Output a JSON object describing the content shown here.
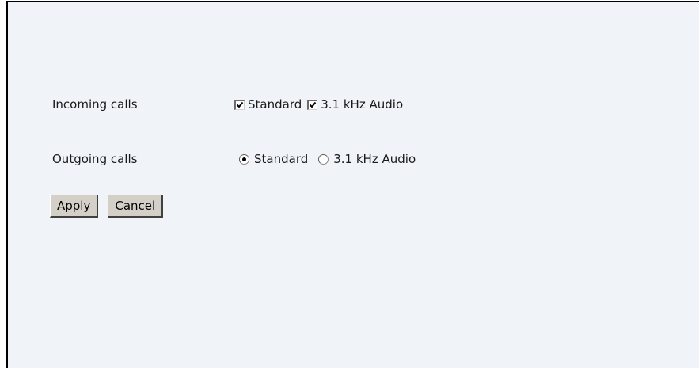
{
  "form": {
    "incoming": {
      "label": "Incoming calls",
      "options": [
        {
          "label": "Standard",
          "checked": true
        },
        {
          "label": "3.1 kHz Audio",
          "checked": true
        }
      ]
    },
    "outgoing": {
      "label": "Outgoing calls",
      "options": [
        {
          "label": "Standard",
          "selected": true
        },
        {
          "label": "3.1 kHz Audio",
          "selected": false
        }
      ]
    }
  },
  "buttons": {
    "apply": "Apply",
    "cancel": "Cancel"
  },
  "colors": {
    "panel_background": "#f0f4f8",
    "button_face": "#d4d0c8"
  }
}
